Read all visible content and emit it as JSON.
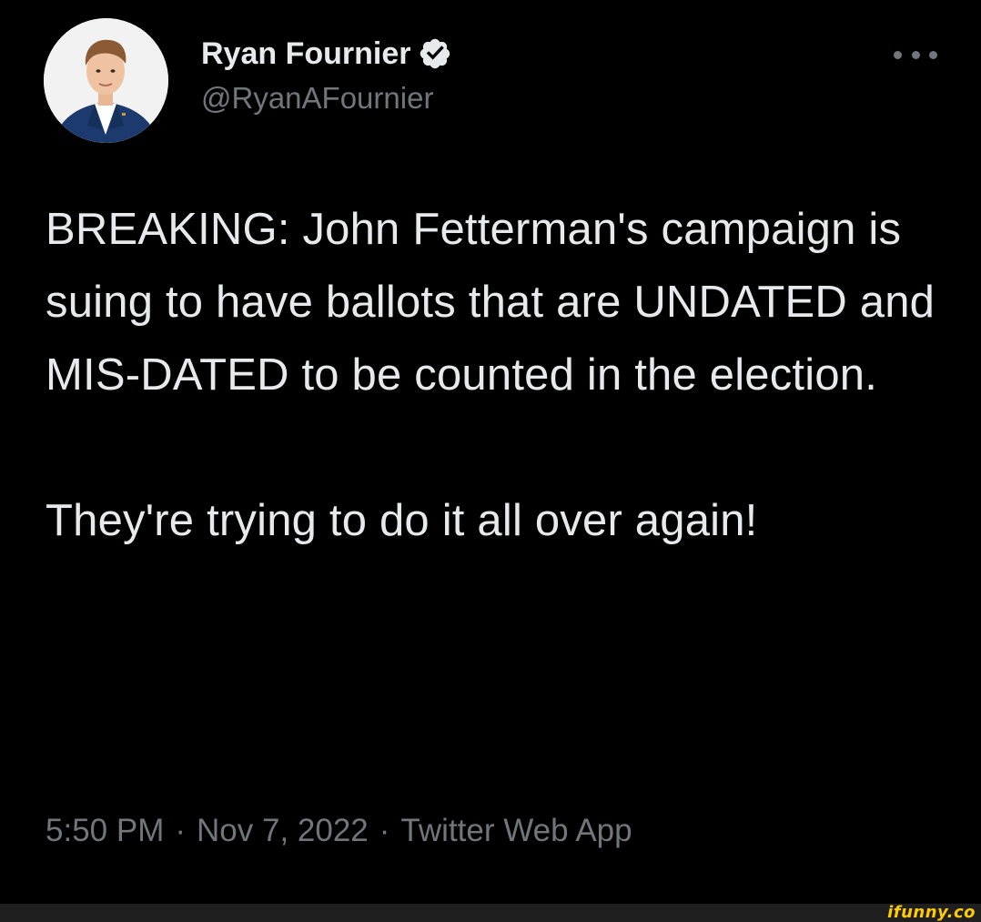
{
  "author": {
    "display_name": "Ryan Fournier",
    "handle": "@RyanAFournier",
    "verified": true,
    "verified_icon": "verified-badge-icon",
    "avatar": "profile-photo"
  },
  "menu": {
    "icon": "more-horizontal-icon"
  },
  "tweet": {
    "paragraph_1": "BREAKING: John Fetterman's campaign is suing to have ballots that are UNDATED and MIS-DATED to be counted in the election.",
    "paragraph_2": "They're trying to do it all over again!"
  },
  "meta": {
    "time": "5:50 PM",
    "separator": "·",
    "date": "Nov 7, 2022",
    "source": "Twitter Web App"
  },
  "watermark": {
    "text": "ifunny.co"
  },
  "colors": {
    "background": "#000000",
    "text_primary": "#e7e9ea",
    "text_secondary": "#71767b",
    "verified_blue": "#1d9bf0",
    "watermark_yellow": "#ffcc00"
  }
}
